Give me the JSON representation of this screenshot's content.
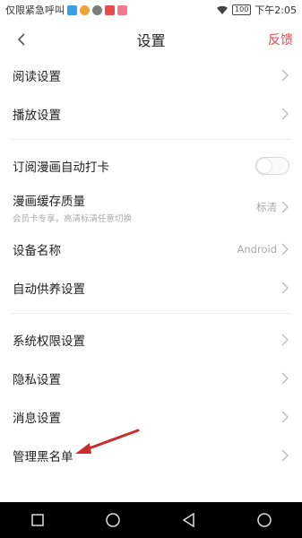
{
  "statusbar": {
    "carrier": "仅限紧急呼叫",
    "battery": "100",
    "time": "下午2:05"
  },
  "navbar": {
    "title": "设置",
    "feedback": "反馈",
    "back_icon": "chevron-left-icon"
  },
  "sections": [
    {
      "rows": [
        {
          "label": "阅读设置"
        },
        {
          "label": "播放设置"
        }
      ]
    },
    {
      "rows": [
        {
          "label": "订阅漫画自动打卡"
        },
        {
          "label": "漫画缓存质量",
          "sub": "会员卡专享，高清标清任意切换",
          "value": "标清"
        },
        {
          "label": "设备名称",
          "value": "Android"
        },
        {
          "label": "自动供养设置"
        }
      ]
    },
    {
      "rows": [
        {
          "label": "系统权限设置"
        },
        {
          "label": "隐私设置"
        },
        {
          "label": "消息设置"
        },
        {
          "label": "管理黑名单"
        }
      ]
    }
  ],
  "colors": {
    "accent": "#e8474c",
    "arrow": "#c8302f"
  }
}
